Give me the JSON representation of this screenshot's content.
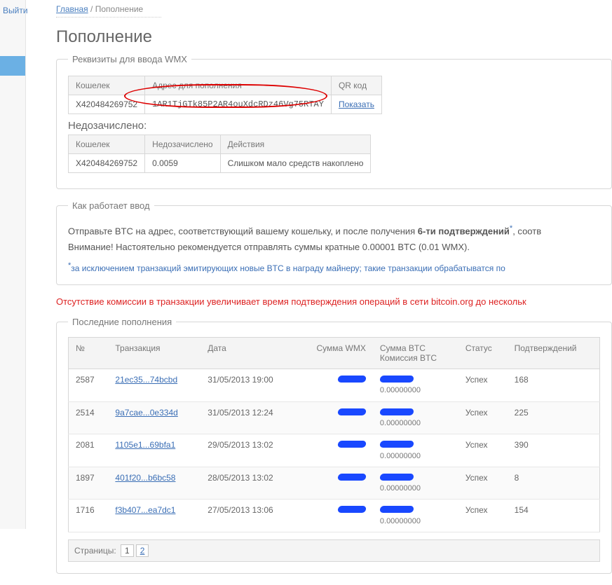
{
  "nav": {
    "exit": "Выйти"
  },
  "crumbs": {
    "home": "Главная",
    "current": "Пополнение",
    "sep": " / "
  },
  "page": {
    "title": "Пополнение"
  },
  "requisites": {
    "legend": "Реквизиты для ввода WMX",
    "cols": {
      "wallet": "Кошелек",
      "address": "Адрес для пополнения",
      "qr": "QR код"
    },
    "wallet": "X420484269752",
    "address": "1AR1TjGTk85P2AR4ouXdcRDz46Vg75RTAY",
    "show": "Показать"
  },
  "uncredited": {
    "title": "Недозачислено:",
    "cols": {
      "wallet": "Кошелек",
      "amount": "Недозачислено",
      "actions": "Действия"
    },
    "wallet": "X420484269752",
    "amount": "0.0059",
    "action_text": "Слишком мало средств накоплено"
  },
  "howto": {
    "legend": "Как работает ввод",
    "p1a": "Отправьте BTC на адрес, соответствующий вашему кошельку, и после получения ",
    "p1b": "6-ти подтверждений",
    "p1c": ", соотв",
    "p2": "Внимание! Настоятельно рекомендуется отправлять суммы кратные 0.00001 BTC (0.01 WMX).",
    "note": "за исключением транзакций эмитирующих новые BTC в награду майнеру; такие транзакции обрабатыватся по"
  },
  "warning": "Отсутствие комиссии в транзакции увеличивает время подтверждения операций в сети bitcoin.org до нескольк",
  "recent": {
    "legend": "Последние пополнения",
    "cols": {
      "no": "№",
      "tx": "Транзакция",
      "date": "Дата",
      "sum_wmx": "Сумма WMX",
      "sum_btc_a": "Сумма BTC",
      "sum_btc_b": "Комиссия BTC",
      "status": "Статус",
      "conf": "Подтверждений"
    },
    "fee_zero": "0.00000000",
    "status_ok": "Успех",
    "rows": [
      {
        "no": "2587",
        "tx": "21ec35...74bcbd",
        "date": "31/05/2013 19:00",
        "conf": "168"
      },
      {
        "no": "2514",
        "tx": "9a7cae...0e334d",
        "date": "31/05/2013 12:24",
        "conf": "225"
      },
      {
        "no": "2081",
        "tx": "1105e1...69bfa1",
        "date": "29/05/2013 13:02",
        "conf": "390"
      },
      {
        "no": "1897",
        "tx": "401f20...b6bc58",
        "date": "28/05/2013 13:02",
        "conf": "8"
      },
      {
        "no": "1716",
        "tx": "f3b407...ea7dc1",
        "date": "27/05/2013 13:06",
        "conf": "154"
      }
    ]
  },
  "pager": {
    "label": "Страницы:",
    "pages": [
      "1",
      "2"
    ],
    "current": "1"
  }
}
